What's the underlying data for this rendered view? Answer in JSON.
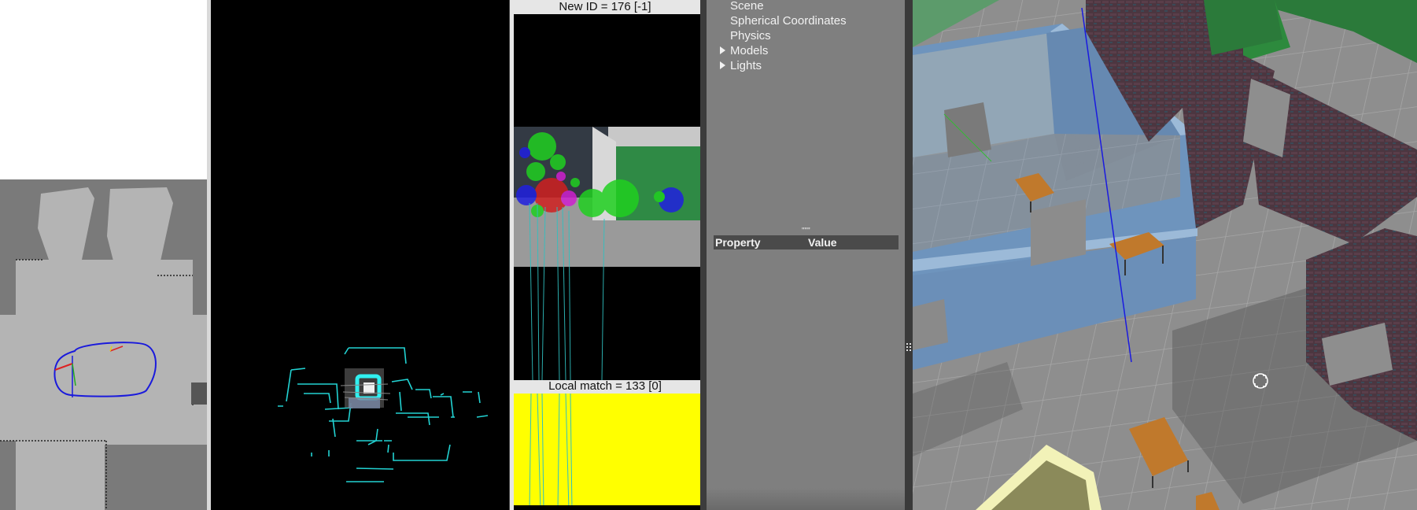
{
  "loop_closure": {
    "new_id_label": "New ID = 176 [-1]",
    "local_match_label": "Local match = 133 [0]"
  },
  "world_tree": {
    "items": [
      {
        "label": "Scene",
        "expandable": false
      },
      {
        "label": "Spherical Coordinates",
        "expandable": false
      },
      {
        "label": "Physics",
        "expandable": false
      },
      {
        "label": "Models",
        "expandable": true
      },
      {
        "label": "Lights",
        "expandable": true
      }
    ],
    "properties_header": {
      "property": "Property",
      "value": "Value"
    },
    "splitter_grip": "\"\"\""
  },
  "colors": {
    "map_free": "#b4b4b4",
    "map_unknown": "#7a7a7a",
    "trajectory": "#1a1adc",
    "cloud": "#22d3d3",
    "loop_yellow": "#ffff00",
    "wall_blue": "#6e94bd",
    "panel_gray": "#7f7f7f"
  },
  "icons": [
    "expand-arrow-icon",
    "move-cursor-icon",
    "splitter-grip-icon"
  ]
}
